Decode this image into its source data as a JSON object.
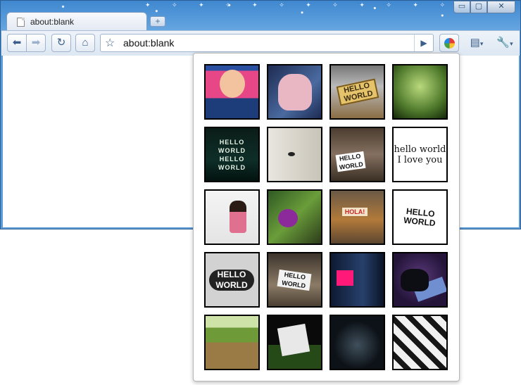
{
  "window": {
    "tab_title": "about:blank",
    "new_tab_glyph": "+",
    "controls": {
      "minimize": "▭",
      "maximize": "▢",
      "close": "✕"
    }
  },
  "toolbar": {
    "back_glyph": "⬅",
    "forward_glyph": "➡",
    "reload_glyph": "↻",
    "home_glyph": "⌂",
    "star_glyph": "☆",
    "url": "about:blank",
    "go_glyph": "▶",
    "page_menu_glyph": "▤",
    "wrench_menu_glyph": "🔧",
    "caret": "▾"
  },
  "popup": {
    "thumbnails": [
      {
        "name": "baby-thumbnail",
        "caption": ""
      },
      {
        "name": "hand-thumbnail",
        "caption": ""
      },
      {
        "name": "hello-world-sign-thumbnail",
        "caption": "HELLO\nWORLD"
      },
      {
        "name": "butterfly-thumbnail",
        "caption": ""
      },
      {
        "name": "hello-world-neon-thumbnail",
        "caption": "HELLO WORLD\nHELLO WORLD"
      },
      {
        "name": "mask-thumbnail",
        "caption": ""
      },
      {
        "name": "hello-world-alley-thumbnail",
        "caption": "HELLO\nWORLD"
      },
      {
        "name": "hello-world-text-thumbnail",
        "caption": "hello world\nI love you"
      },
      {
        "name": "girl-thumbnail",
        "caption": ""
      },
      {
        "name": "flower-thumbnail",
        "caption": ""
      },
      {
        "name": "magazine-thumbnail",
        "caption": "HOLA!"
      },
      {
        "name": "hello-world-pixel-thumbnail",
        "caption": "HELLO\nWORLD"
      },
      {
        "name": "hello-world-bubble-thumbnail",
        "caption": "HELLO\nWORLD"
      },
      {
        "name": "hello-world-street-thumbnail",
        "caption": "HELLO\nWORLD"
      },
      {
        "name": "pink-robot-thumbnail",
        "caption": ""
      },
      {
        "name": "shoes-thumbnail",
        "caption": ""
      },
      {
        "name": "park-thumbnail",
        "caption": ""
      },
      {
        "name": "boxes-thumbnail",
        "caption": ""
      },
      {
        "name": "light-trail-thumbnail",
        "caption": ""
      },
      {
        "name": "puzzle-pattern-thumbnail",
        "caption": ""
      }
    ]
  }
}
